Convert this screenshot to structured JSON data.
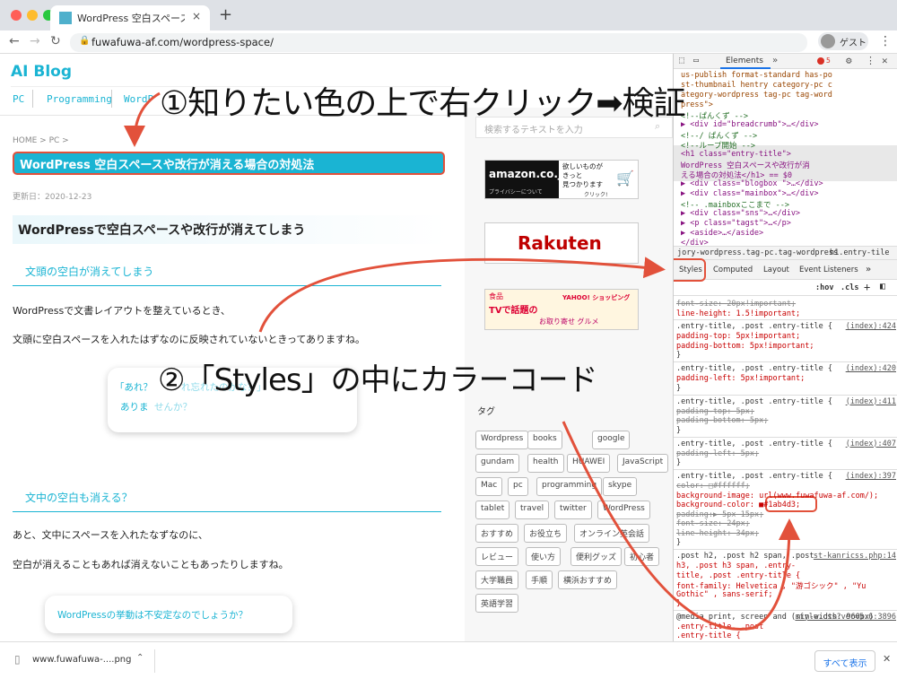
{
  "browser": {
    "tab_title": "WordPress 空白スペースや改行が",
    "tab_close": "×",
    "new_tab": "+",
    "url": "fuwafuwa-af.com/wordpress-space/",
    "guest_label": "ゲスト"
  },
  "page": {
    "blog_title": "AI Blog",
    "nav": [
      "PC",
      "Programming",
      "WordP"
    ],
    "breadcrumb": "HOME  >  PC  >",
    "entry_title": "WordPress 空白スペースや改行が消える場合の対処法",
    "updated": "更新日：2020-12-23",
    "h2": "WordPressで空白スペースや改行が消えてしまう",
    "h3_1": "文頭の空白が消えてしまう",
    "p1": "WordPressで文書レイアウトを整えているとき、",
    "p2": "文頭に空白スペースを入れたはずなのに反映されていないときってありますね。",
    "bubble1_line1": "「あれ？",
    "bubble1_line1b": "れ忘れたのかな？」",
    "bubble1_line2": "ありま",
    "bubble1_line2b": "せんか？",
    "h3_2": "文中の空白も消える？",
    "p3": "あと、文中にスペースを入れたなずなのに、",
    "p4": "空白が消えることもあれば消えないこともあったりしますね。",
    "bubble2": "WordPressの挙動は不安定なのでしょうか？"
  },
  "sidebar": {
    "search_placeholder": "検索するテキストを入力",
    "ad_amazon": "amazon.co.jp",
    "ad_amazon_sub": "プライバシーについて",
    "ad_amazon_copy": "欲しいものが\nきっと\n見つかります",
    "ad_amazon_click": "クリック!",
    "ad_rakuten": "Rakuten",
    "ad_yahoo_food": "食品",
    "ad_yahoo_tv": "TVで話題の",
    "ad_yahoo_brand": "YAHOO! ショッピング",
    "ad_yahoo_bottom": "お取り寄せ グルメ",
    "tag_title": "タグ",
    "tags": [
      "Wordpress",
      "books",
      "google",
      "gundam",
      "health",
      "HUAWEI",
      "JavaScript",
      "Mac",
      "pc",
      "programming",
      "skype",
      "tablet",
      "travel",
      "twitter",
      "WordPress",
      "おすすめ",
      "お役立ち",
      "オンライン英会話",
      "レビュー",
      "使い方",
      "便利グッズ",
      "初心者",
      "大学職員",
      "手順",
      "横浜おすすめ",
      "英語学習"
    ]
  },
  "devtools": {
    "tab_elements": "Elements",
    "more": "»",
    "error_count": "5",
    "dom_lines": [
      "us-publish format-standard has-po",
      "st-thumbnail hentry category-pc c",
      "ategory-wordpress tag-pc tag-word",
      "press\">",
      "  <!--ぱんくず -->",
      "▶ <div id=\"breadcrumb\">…</div>",
      "  <!--/ ぱんくず -->",
      "  <!--ループ開始 -->",
      "  <h1 class=\"entry-title\">",
      "  WordPress 空白スペースや改行が消",
      "  える場合の対処法</h1> == $0",
      "▶ <div class=\"blogbox \">…</div>",
      "▶ <div class=\"mainbox\">…</div>",
      "  <!-- .mainboxここまで -->",
      "▶ <div class=\"sns\">…</div>",
      "▶ <p class=\"tagst\">…</p>",
      "▶ <aside>…</aside>",
      "  </div>"
    ],
    "crumb_left": "jory-wordpress.tag-pc.tag-wordpress",
    "crumb_right": "h1.entry-tile",
    "style_tabs": [
      "Styles",
      "Computed",
      "Layout",
      "Event Listeners"
    ],
    "filter_hov": ":hov",
    "filter_cls": ".cls",
    "rules": [
      {
        "sel": "",
        "lines": [
          "  font-size: 20px!important;",
          "  line-height: 1.5!important;"
        ],
        "src": "",
        "strike": [
          true,
          false
        ]
      },
      {
        "sel": ".entry-title, .post .entry-title {",
        "lines": [
          "  padding-top: 5px!important;",
          "  padding-bottom: 5px!important;"
        ],
        "src": "(index):424",
        "strike": [
          false,
          false
        ]
      },
      {
        "sel": ".entry-title, .post .entry-title {",
        "lines": [
          "  padding-left: 5px!important;"
        ],
        "src": "(index):420",
        "strike": [
          false
        ]
      },
      {
        "sel": ".entry-title, .post .entry-title {",
        "lines": [
          "  padding-top: 5px;",
          "  padding-bottom: 5px;"
        ],
        "src": "(index):411",
        "strike": [
          true,
          true
        ]
      },
      {
        "sel": ".entry-title, .post .entry-title {",
        "lines": [
          "  padding-left: 5px;"
        ],
        "src": "(index):407",
        "strike": [
          true
        ]
      },
      {
        "sel": ".entry-title, .post .entry-title {",
        "lines": [
          "  color: □#ffffff;",
          "  background-image: url(www.fuwafuwa-af.com/);",
          "  background-color: ■#1ab4d3;",
          "  padding:▶ 5px 15px;",
          "  font-size: 24px;",
          "  line-height: 34px;"
        ],
        "src": "(index):397",
        "strike": [
          true,
          false,
          false,
          true,
          true,
          true
        ]
      },
      {
        "sel": ".post h2, .post h2 span, .post",
        "lines": [
          "h3, .post h3 span, .entry-",
          "title, .post .entry-title {",
          "  font-family: Helvetica , \"游ゴシック\" , \"Yu",
          "    Gothic\" , sans-serif;",
          "}"
        ],
        "src": "st-kanricss.php:14",
        "strike": [
          false,
          false,
          false,
          false,
          false
        ]
      },
      {
        "sel": "@media print, screen and (min-width: 960px)",
        "lines": [
          ".entry-title, .post",
          "  .entry-title {",
          "  font-size: 27px;"
        ],
        "src": "style.css?ver=5.6:3896",
        "strike": [
          false,
          false,
          true
        ]
      }
    ],
    "color_value": "#1ab4d3",
    "color_swatch": "#1ab4d3"
  },
  "download": {
    "filename": "www.fuwafuwa-....png",
    "show_all": "すべて表示"
  },
  "annotations": {
    "step1": "①知りたい色の上で右クリック➡検証",
    "step2": "②「Styles」の中にカラーコード",
    "accent": "#e2513b"
  }
}
